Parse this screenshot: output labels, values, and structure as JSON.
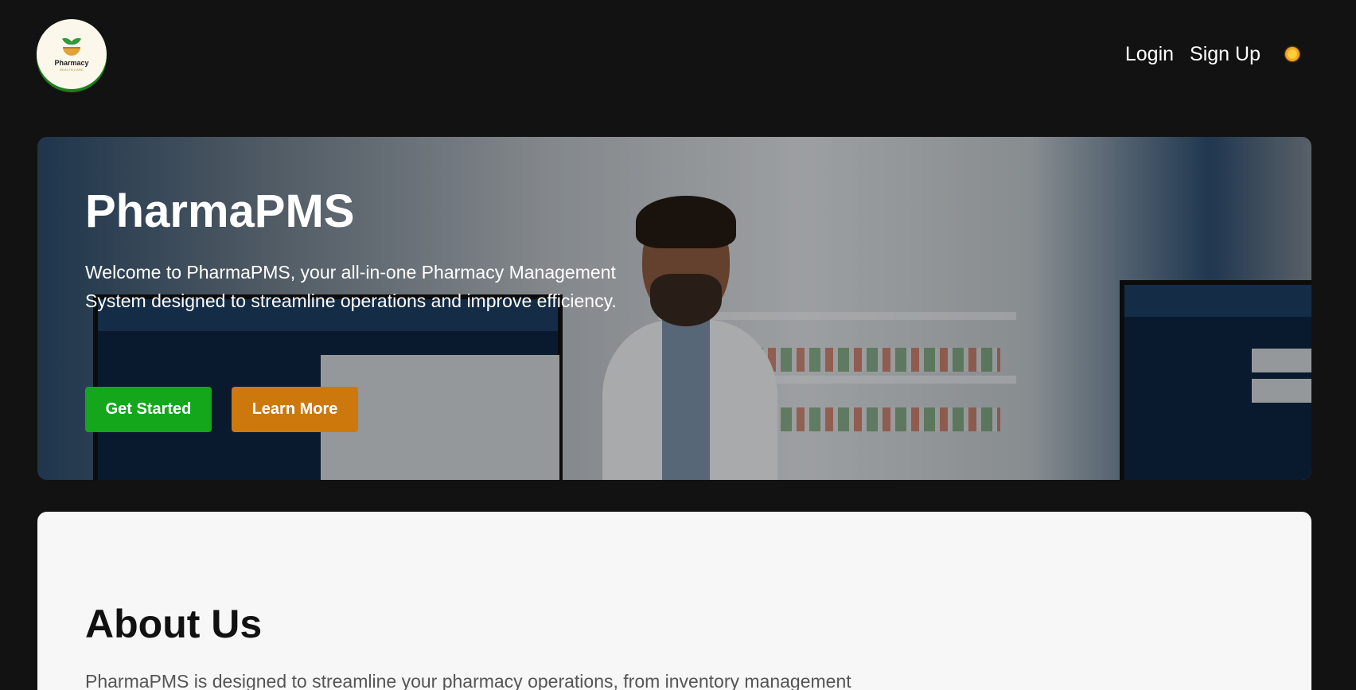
{
  "nav": {
    "logo_text": "Pharmacy",
    "logo_subtext": "HEALTH CARE",
    "login_label": "Login",
    "signup_label": "Sign Up",
    "theme_icon": "sun-icon"
  },
  "hero": {
    "title": "PharmaPMS",
    "description": "Welcome to PharmaPMS, your all-in-one Pharmacy Management System designed to streamline operations and improve efficiency.",
    "get_started_label": "Get Started",
    "learn_more_label": "Learn More"
  },
  "about": {
    "title": "About Us",
    "text": "PharmaPMS is designed to streamline your pharmacy operations, from inventory management"
  },
  "colors": {
    "background": "#121212",
    "green_button": "#14a61b",
    "orange_button": "#cc780c",
    "card": "#f7f7f7"
  }
}
